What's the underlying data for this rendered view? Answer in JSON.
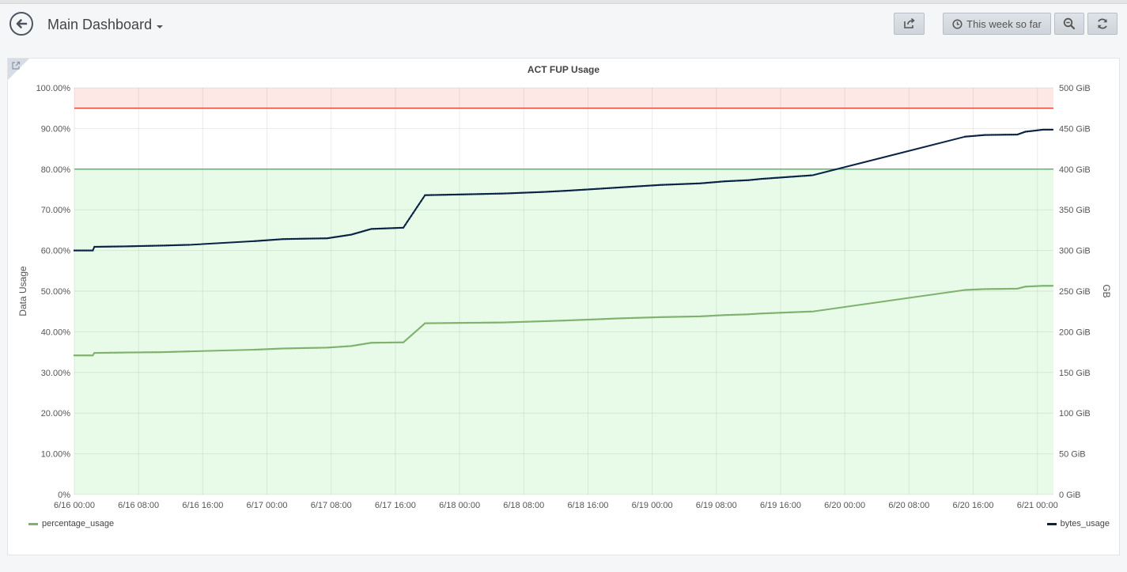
{
  "header": {
    "dashboard_title": "Main Dashboard",
    "time_range_label": "This week so far"
  },
  "icons": {
    "back": "back-arrow-icon",
    "share": "share-icon",
    "clock": "clock-icon",
    "zoom": "zoom-out-icon",
    "refresh": "refresh-icon",
    "panel_link": "external-link-icon"
  },
  "colors": {
    "bytes_series": "#0a2345",
    "percentage_series": "#7eb26d",
    "critical_threshold": "#e24d42",
    "warning_threshold": "#56b869",
    "critical_band": "#fde8e6",
    "ok_band": "#e8fbe9"
  },
  "chart_data": {
    "type": "line",
    "title": "ACT FUP Usage",
    "ylabel": "Data Usage",
    "y2label": "GB",
    "ylim": [
      0,
      100
    ],
    "y2lim": [
      0,
      500
    ],
    "xlim": [
      "6/16 00:00",
      "6/21 02:00"
    ],
    "x_ticks": [
      "6/16 00:00",
      "6/16 08:00",
      "6/16 16:00",
      "6/17 00:00",
      "6/17 08:00",
      "6/17 16:00",
      "6/18 00:00",
      "6/18 08:00",
      "6/18 16:00",
      "6/19 00:00",
      "6/19 08:00",
      "6/19 16:00",
      "6/20 00:00",
      "6/20 08:00",
      "6/20 16:00",
      "6/21 00:00"
    ],
    "y_ticks": [
      "0%",
      "10.00%",
      "20.00%",
      "30.00%",
      "40.00%",
      "50.00%",
      "60.00%",
      "70.00%",
      "80.00%",
      "90.00%",
      "100.00%"
    ],
    "y2_ticks": [
      "0 GiB",
      "50 GiB",
      "100 GiB",
      "150 GiB",
      "200 GiB",
      "250 GiB",
      "300 GiB",
      "350 GiB",
      "400 GiB",
      "450 GiB",
      "500 GiB"
    ],
    "thresholds": [
      {
        "value": 80,
        "kind": "ok",
        "fill": "below"
      },
      {
        "value": 95,
        "kind": "critical",
        "fill": "above"
      }
    ],
    "grid": true,
    "legend_position": "bottom",
    "x_hours": [
      0,
      2.3,
      2.5,
      6,
      11,
      14.5,
      22.5,
      26,
      31.5,
      34.5,
      37,
      41,
      43.7,
      48.5,
      53.5,
      58.5,
      61.5,
      68,
      73,
      78,
      81,
      84,
      85.6,
      92,
      111,
      113.5,
      117.5,
      118.5,
      120.7,
      122
    ],
    "series": [
      {
        "name": "bytes_usage",
        "axis": "right",
        "unit": "GiB",
        "values": [
          300,
          300,
          304.5,
          305,
          306,
          307,
          311.5,
          314,
          315,
          319.5,
          326.5,
          328,
          368,
          369,
          370,
          372,
          373.5,
          377.5,
          380.5,
          382.5,
          385,
          386.5,
          388,
          392.5,
          440,
          442,
          442.5,
          446,
          448.5,
          448.5
        ]
      },
      {
        "name": "percentage_usage",
        "axis": "left",
        "unit": "%",
        "values": [
          34.2,
          34.2,
          34.8,
          34.9,
          35,
          35.2,
          35.6,
          35.9,
          36.1,
          36.5,
          37.3,
          37.4,
          42.1,
          42.2,
          42.3,
          42.6,
          42.8,
          43.3,
          43.6,
          43.8,
          44.1,
          44.3,
          44.5,
          45,
          50.3,
          50.5,
          50.6,
          51.1,
          51.3,
          51.3
        ]
      }
    ]
  }
}
